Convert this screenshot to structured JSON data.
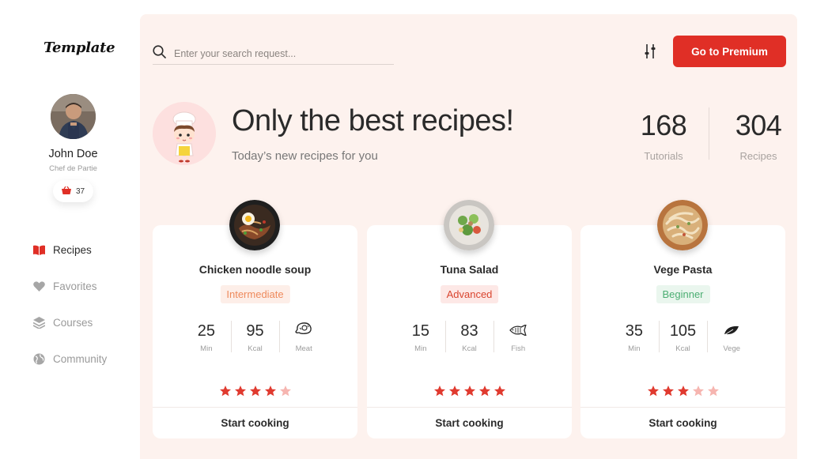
{
  "brand": {
    "logo": "Template"
  },
  "user": {
    "name": "John Doe",
    "role": "Chef de Partie",
    "badge_count": "37"
  },
  "nav": [
    {
      "label": "Recipes",
      "icon": "book-icon",
      "active": true
    },
    {
      "label": "Favorites",
      "icon": "heart-icon",
      "active": false
    },
    {
      "label": "Courses",
      "icon": "layers-icon",
      "active": false
    },
    {
      "label": "Community",
      "icon": "globe-icon",
      "active": false
    }
  ],
  "search": {
    "placeholder": "Enter your search request..."
  },
  "header": {
    "premium_label": "Go to Premium"
  },
  "hero": {
    "title": "Only the best recipes!",
    "subtitle": "Today’s new recipes for you"
  },
  "stats": {
    "tutorials": {
      "value": "168",
      "label": "Tutorials"
    },
    "recipes": {
      "value": "304",
      "label": "Recipes"
    }
  },
  "cards": [
    {
      "name": "Chicken noodle soup",
      "level": "Intermediate",
      "time": "25",
      "time_unit": "Min",
      "kcal": "95",
      "kcal_unit": "Kcal",
      "type": "Meat",
      "type_icon": "meat-icon",
      "rating": 4,
      "cta": "Start cooking"
    },
    {
      "name": "Tuna Salad",
      "level": "Advanced",
      "time": "15",
      "time_unit": "Min",
      "kcal": "83",
      "kcal_unit": "Kcal",
      "type": "Fish",
      "type_icon": "fish-icon",
      "rating": 5,
      "cta": "Start cooking"
    },
    {
      "name": "Vege Pasta",
      "level": "Beginner",
      "time": "35",
      "time_unit": "Min",
      "kcal": "105",
      "kcal_unit": "Kcal",
      "type": "Vege",
      "type_icon": "leaf-icon",
      "rating": 3,
      "cta": "Start cooking"
    }
  ],
  "colors": {
    "accent": "#e02f26",
    "panel": "#fdf2ee",
    "star_on": "#e03a2f",
    "star_off": "#f6b5b0"
  }
}
